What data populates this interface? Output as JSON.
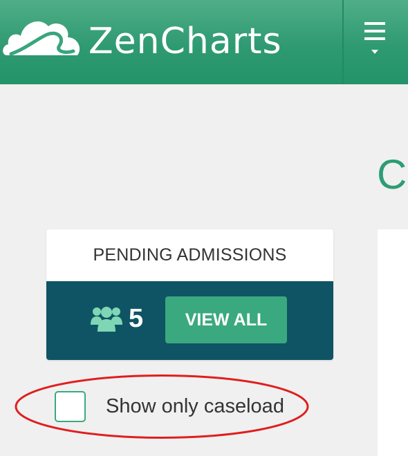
{
  "header": {
    "brand": "ZenCharts",
    "logo_icon": "cloud-logo-icon",
    "menu_icon": "hamburger-menu-icon"
  },
  "main": {
    "partial_heading": "C"
  },
  "pending_admissions": {
    "title": "PENDING ADMISSIONS",
    "icon": "people-group-icon",
    "count": "5",
    "view_all_label": "VIEW ALL"
  },
  "caseload_filter": {
    "label": "Show only caseload",
    "checked": false
  },
  "colors": {
    "brand_green": "#2f9a72",
    "card_teal": "#0f5464",
    "button_green": "#3aa97f",
    "icon_mint": "#7fd6b4",
    "annotation_red": "#e01e1e"
  }
}
